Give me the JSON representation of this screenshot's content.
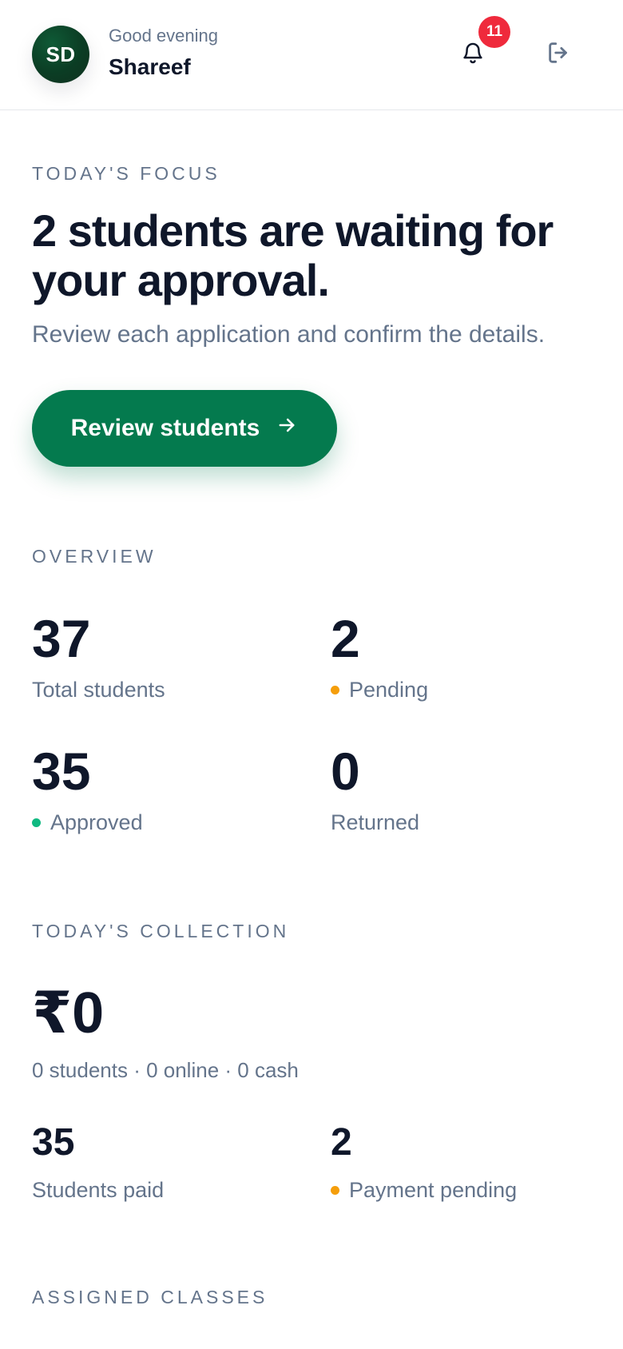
{
  "header": {
    "avatar_initials": "SD",
    "greeting": "Good evening",
    "user_name": "Shareef",
    "notification_count": "11",
    "icons": {
      "notifications": "bell-icon",
      "logout": "logout-icon"
    }
  },
  "focus": {
    "label": "TODAY'S FOCUS",
    "headline": "2 students are waiting for your approval.",
    "subtitle": "Review each application and confirm the details.",
    "cta_label": "Review students",
    "cta_icon": "arrow-right-icon"
  },
  "overview": {
    "label": "OVERVIEW",
    "total_students": {
      "value": "37",
      "label": "Total students"
    },
    "pending": {
      "value": "2",
      "label": "Pending"
    },
    "approved": {
      "value": "35",
      "label": "Approved"
    },
    "returned": {
      "value": "0",
      "label": "Returned"
    }
  },
  "collection": {
    "label": "TODAY'S COLLECTION",
    "amount": "₹0",
    "breakdown": "0 students · 0 online · 0 cash",
    "students_paid": {
      "value": "35",
      "label": "Students paid"
    },
    "payment_pending": {
      "value": "2",
      "label": "Payment pending"
    }
  },
  "assigned": {
    "label": "ASSIGNED CLASSES"
  },
  "colors": {
    "primary": "#047a4e",
    "badge": "#ef2a3c",
    "pending_dot": "#f59e0b",
    "approved_dot": "#10b981",
    "text_dark": "#0f172a",
    "text_muted": "#64748b"
  }
}
